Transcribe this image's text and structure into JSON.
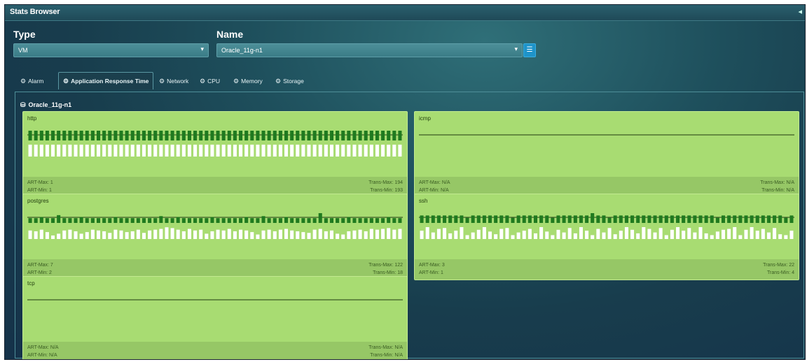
{
  "window": {
    "title": "Stats Browser",
    "collapse_icon": "collapse-icon"
  },
  "type_field": {
    "label": "Type",
    "value": "VM"
  },
  "name_field": {
    "label": "Name",
    "value": "Oracle_11g-n1"
  },
  "tabs": [
    {
      "label": "Alarm",
      "icon": "gear-icon",
      "active": false
    },
    {
      "label": "Application Response Time",
      "icon": "gear-icon",
      "active": true
    },
    {
      "label": "Network",
      "icon": "gear-icon",
      "active": false
    },
    {
      "label": "CPU",
      "icon": "gear-icon",
      "active": false
    },
    {
      "label": "Memory",
      "icon": "gear-icon",
      "active": false
    },
    {
      "label": "Storage",
      "icon": "gear-icon",
      "active": false
    }
  ],
  "vm_heading": "Oracle_11g-n1",
  "colors": {
    "card_bg": "#a8dc72",
    "dark_bar": "#1f7a1f",
    "light_bar": "#ffffff",
    "accent": "#1e93c9"
  },
  "cards": [
    {
      "name": "http",
      "art_max": "ART-Max: 1",
      "art_min": "ART-Min: 1",
      "trans_max": "Trans-Max: 194",
      "trans_min": "Trans-Min: 193",
      "art_series": [
        1,
        1,
        1,
        1,
        1,
        1,
        1,
        1,
        1,
        1,
        1,
        1,
        1,
        1,
        1,
        1,
        1,
        1,
        1,
        1,
        1,
        1,
        1,
        1,
        1,
        1,
        1,
        1,
        1,
        1,
        1,
        1,
        1,
        1,
        1,
        1,
        1,
        1,
        1,
        1,
        1,
        1,
        1,
        1,
        1,
        1,
        1,
        1,
        1,
        1,
        1,
        1,
        1,
        1,
        1,
        1,
        1,
        1,
        1,
        1,
        1,
        1,
        1,
        1,
        1,
        1
      ],
      "trans_series": [
        194,
        194,
        194,
        193,
        194,
        194,
        194,
        194,
        193,
        194,
        194,
        194,
        194,
        194,
        193,
        194,
        194,
        194,
        194,
        194,
        194,
        193,
        194,
        194,
        194,
        194,
        194,
        194,
        193,
        194,
        194,
        194,
        194,
        194,
        194,
        193,
        194,
        194,
        194,
        194,
        194,
        194,
        193,
        194,
        194,
        194,
        194,
        194,
        194,
        193,
        194,
        194,
        194,
        194,
        194,
        194,
        193,
        194,
        194,
        194,
        194,
        194,
        194,
        193,
        194,
        194
      ],
      "art_scale": 1,
      "trans_scale": 194
    },
    {
      "name": "icmp",
      "art_max": "ART-Max: N/A",
      "art_min": "ART-Min: N/A",
      "trans_max": "Trans-Max: N/A",
      "trans_min": "Trans-Min: N/A",
      "art_series": [],
      "trans_series": [],
      "art_scale": 1,
      "trans_scale": 1
    },
    {
      "name": "postgres",
      "art_max": "ART-Max: 7",
      "art_min": "ART-Min: 2",
      "trans_max": "Trans-Max: 122",
      "trans_min": "Trans-Min: 18",
      "art_series": [
        2,
        2,
        3,
        2,
        2,
        5,
        2,
        2,
        2,
        3,
        2,
        2,
        2,
        2,
        2,
        3,
        2,
        2,
        2,
        2,
        2,
        2,
        2,
        4,
        2,
        2,
        3,
        2,
        2,
        2,
        2,
        2,
        3,
        2,
        2,
        2,
        2,
        2,
        3,
        2,
        2,
        4,
        2,
        2,
        2,
        3,
        2,
        2,
        2,
        2,
        2,
        7,
        2,
        2,
        2,
        2,
        3,
        2,
        2,
        2,
        2,
        2,
        2,
        3,
        2,
        2
      ],
      "trans_series": [
        80,
        70,
        90,
        60,
        18,
        40,
        80,
        90,
        70,
        40,
        60,
        90,
        80,
        70,
        50,
        90,
        80,
        60,
        70,
        90,
        50,
        80,
        90,
        100,
        120,
        110,
        90,
        70,
        100,
        80,
        90,
        40,
        70,
        90,
        80,
        100,
        70,
        90,
        80,
        60,
        30,
        80,
        90,
        70,
        90,
        100,
        80,
        70,
        60,
        50,
        90,
        100,
        70,
        80,
        40,
        30,
        70,
        80,
        90,
        70,
        100,
        90,
        100,
        110,
        90,
        100
      ],
      "art_scale": 7,
      "trans_scale": 122
    },
    {
      "name": "ssh",
      "art_max": "ART-Max: 3",
      "art_min": "ART-Min: 1",
      "trans_max": "Trans-Max: 22",
      "trans_min": "Trans-Min: 4",
      "art_series": [
        2,
        2,
        2,
        2,
        2,
        2,
        2,
        2,
        1,
        2,
        2,
        2,
        2,
        2,
        2,
        2,
        1,
        2,
        2,
        2,
        2,
        2,
        2,
        1,
        2,
        2,
        2,
        2,
        2,
        2,
        3,
        2,
        2,
        1,
        2,
        2,
        2,
        2,
        2,
        2,
        2,
        2,
        2,
        2,
        2,
        2,
        2,
        2,
        2,
        2,
        2,
        2,
        1,
        2,
        2,
        2,
        2,
        2,
        2,
        2,
        2,
        2,
        2,
        2,
        1,
        2
      ],
      "trans_series": [
        14,
        22,
        10,
        18,
        20,
        8,
        14,
        22,
        4,
        10,
        16,
        22,
        12,
        6,
        18,
        20,
        4,
        10,
        14,
        18,
        8,
        22,
        12,
        4,
        16,
        10,
        20,
        8,
        22,
        14,
        4,
        18,
        10,
        20,
        6,
        14,
        22,
        16,
        8,
        22,
        18,
        10,
        20,
        4,
        16,
        22,
        14,
        20,
        10,
        22,
        8,
        4,
        12,
        16,
        18,
        22,
        4,
        16,
        22,
        14,
        18,
        10,
        20,
        6,
        4,
        14
      ],
      "art_scale": 3,
      "trans_scale": 22
    },
    {
      "name": "tcp",
      "art_max": "ART-Max: N/A",
      "art_min": "ART-Min: N/A",
      "trans_max": "Trans-Max: N/A",
      "trans_min": "Trans-Min: N/A",
      "art_series": [],
      "trans_series": [],
      "art_scale": 1,
      "trans_scale": 1
    }
  ]
}
